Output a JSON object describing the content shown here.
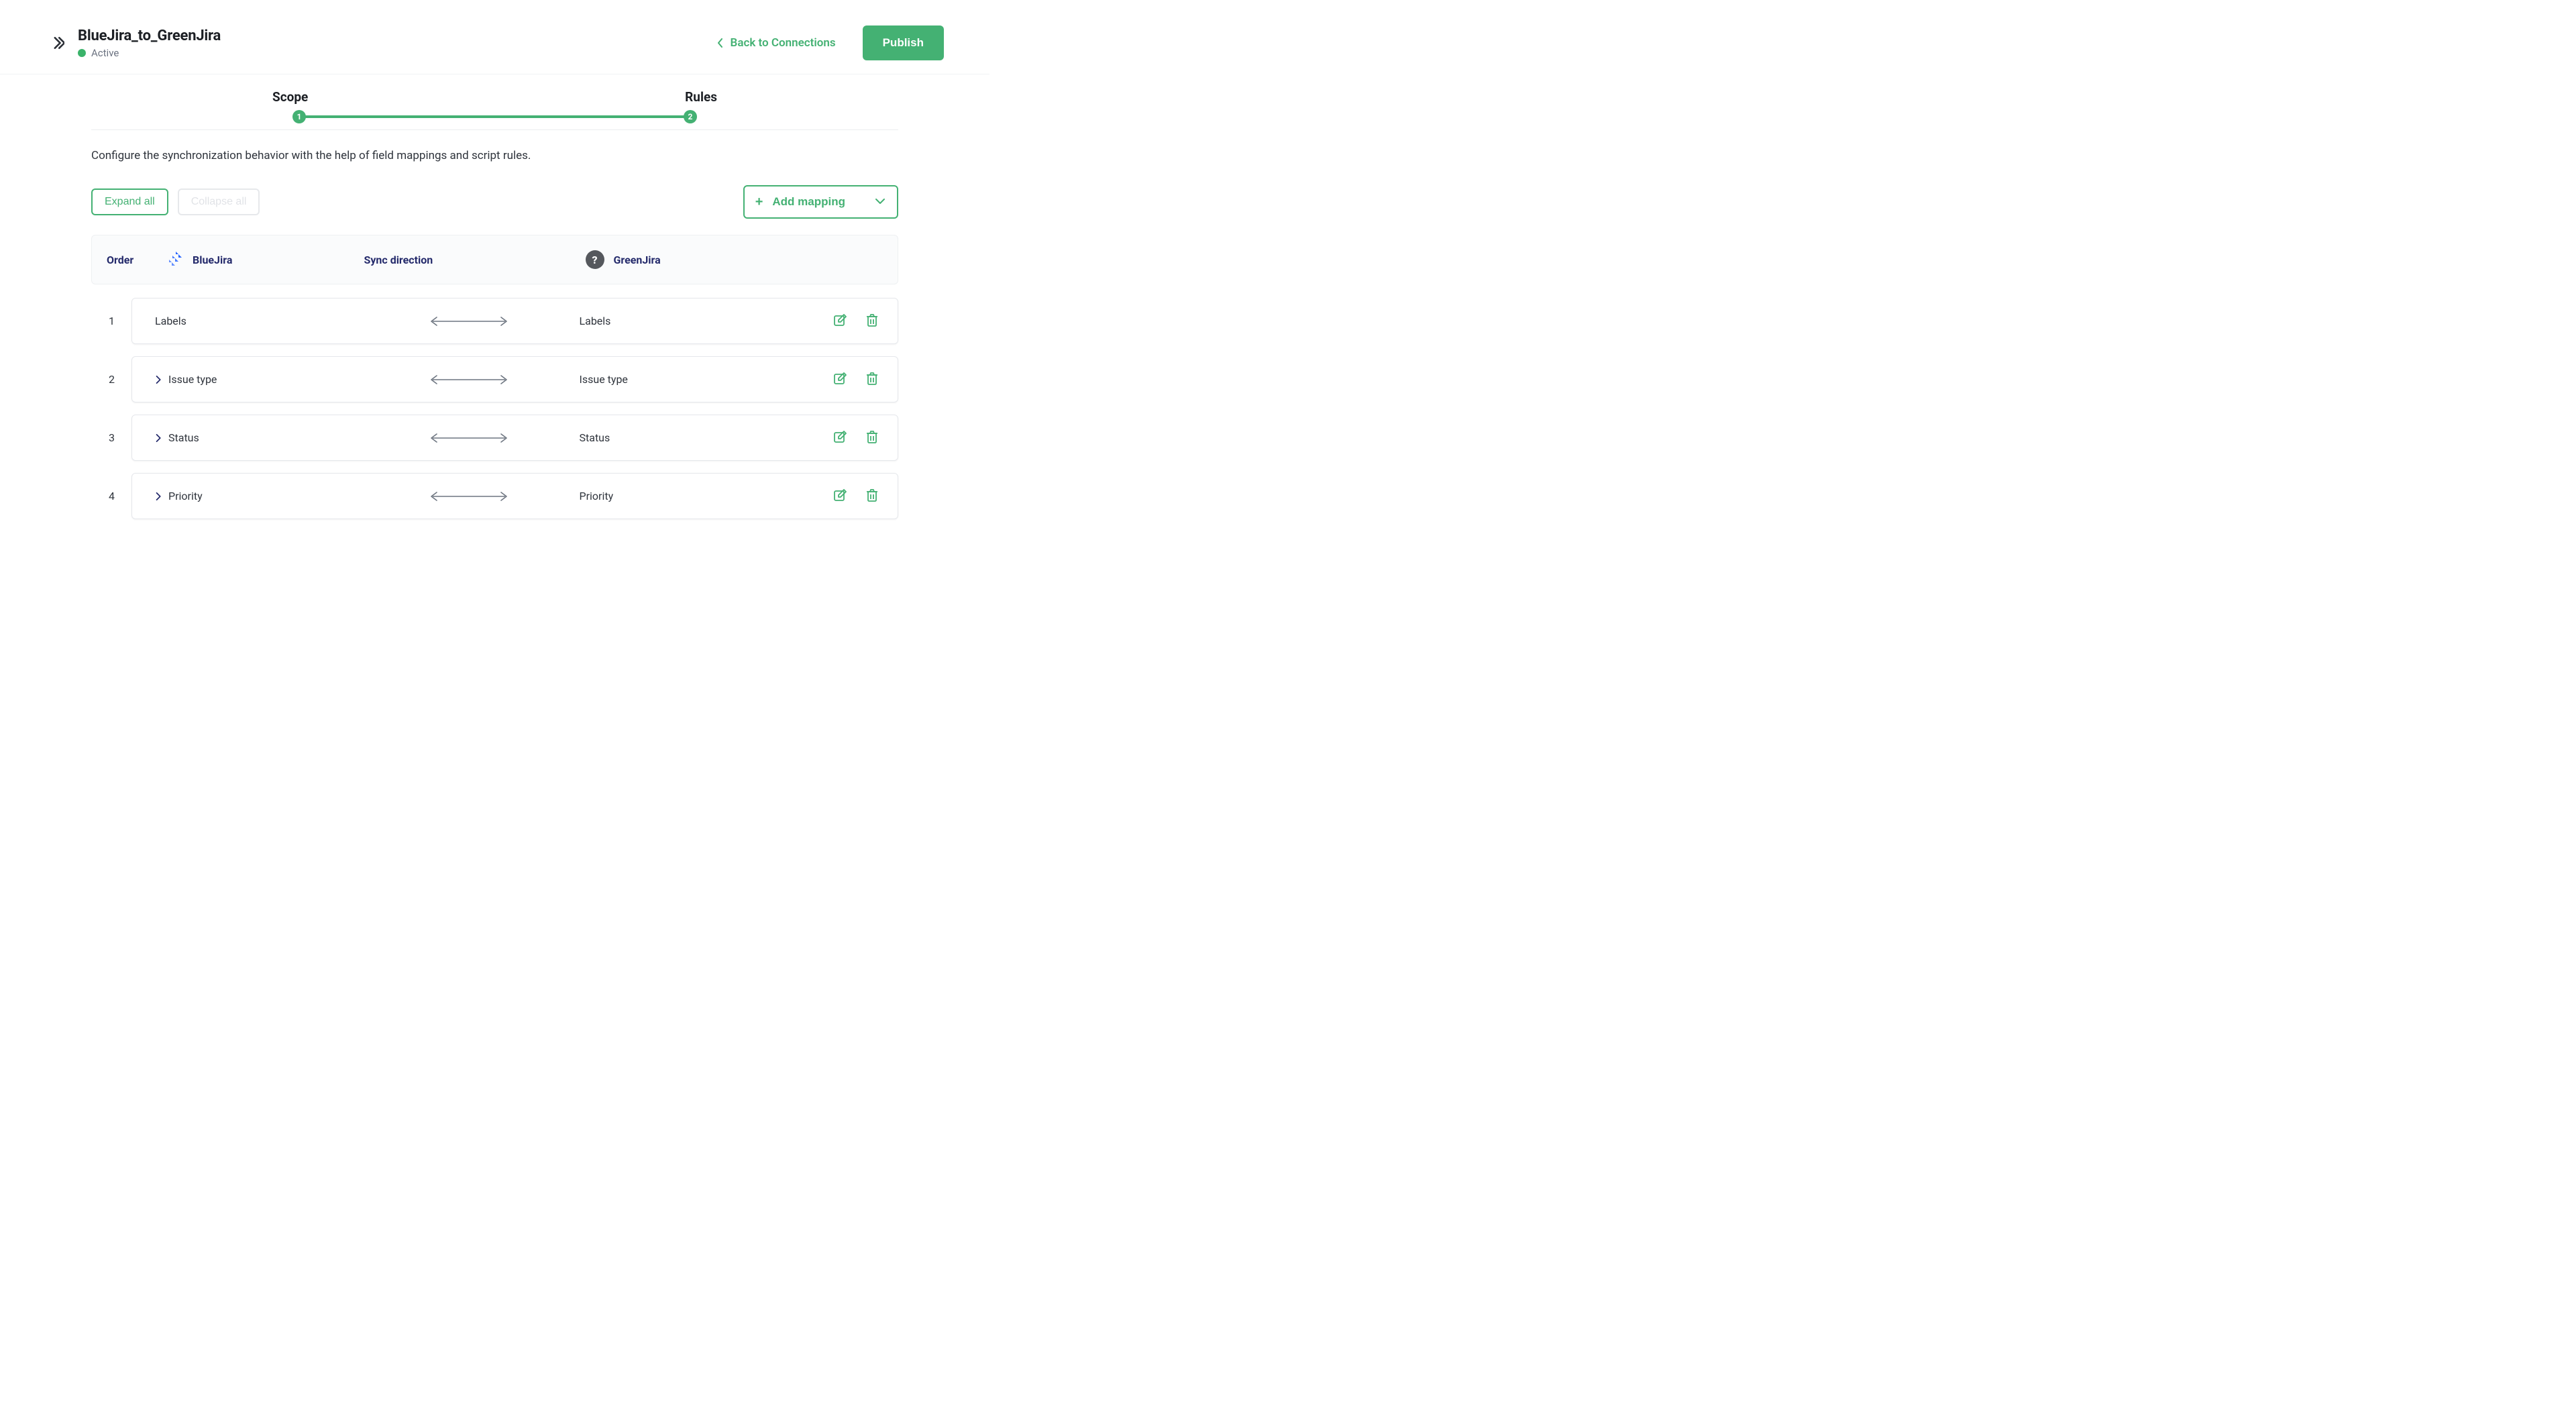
{
  "header": {
    "title": "BlueJira_to_GreenJira",
    "status_label": "Active",
    "back_label": "Back to Connections",
    "publish_label": "Publish"
  },
  "stepper": {
    "steps": [
      "Scope",
      "Rules"
    ],
    "node_labels": [
      "1",
      "2"
    ]
  },
  "instruction": "Configure the synchronization behavior with the help of field mappings and script rules.",
  "actions": {
    "expand_label": "Expand all",
    "collapse_label": "Collapse all",
    "add_mapping_label": "Add mapping"
  },
  "columns": {
    "order": "Order",
    "source": "BlueJira",
    "sync": "Sync direction",
    "target": "GreenJira",
    "help_symbol": "?"
  },
  "rows": [
    {
      "order": "1",
      "source": "Labels",
      "target": "Labels",
      "expandable": false
    },
    {
      "order": "2",
      "source": "Issue type",
      "target": "Issue type",
      "expandable": true
    },
    {
      "order": "3",
      "source": "Status",
      "target": "Status",
      "expandable": true
    },
    {
      "order": "4",
      "source": "Priority",
      "target": "Priority",
      "expandable": true
    }
  ]
}
